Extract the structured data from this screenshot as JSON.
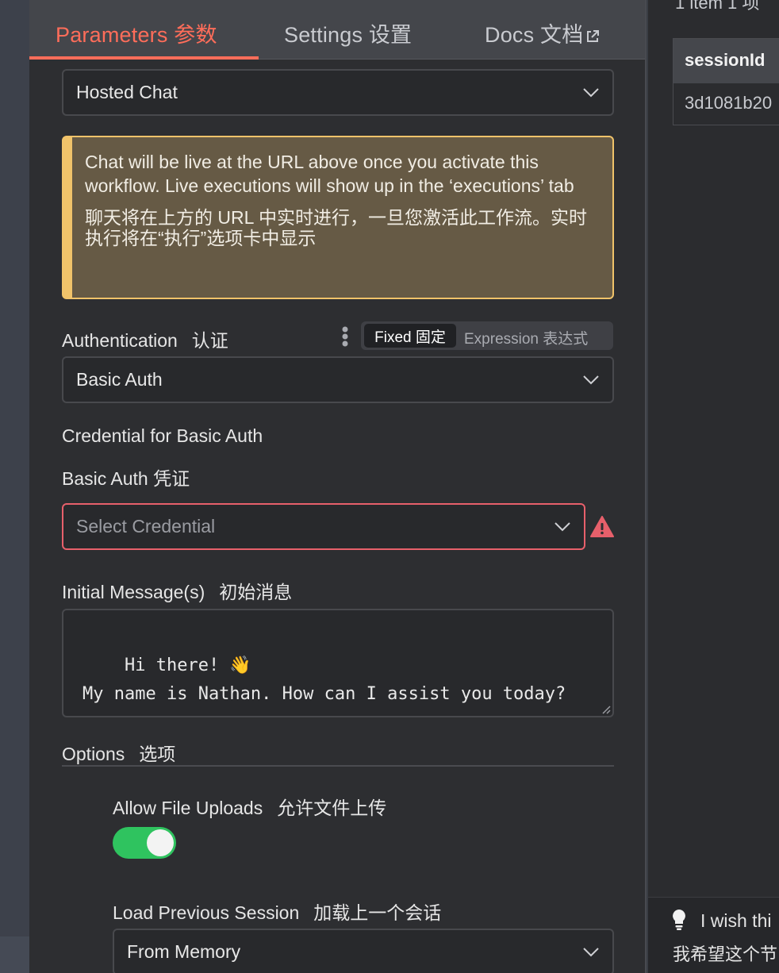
{
  "tabs": {
    "parameters": "Parameters  参数",
    "settings": "Settings  设置",
    "docs": "Docs  文档"
  },
  "mode_select": {
    "value": "Hosted Chat"
  },
  "notice": {
    "en": "Chat will be live at the URL above once you activate this workflow. Live executions will show up in the ‘executions’ tab",
    "zh": "聊天将在上方的 URL 中实时进行，一旦您激活此工作流。实时执行将在“执行”选项卡中显示"
  },
  "authentication": {
    "label": "Authentication",
    "label_zh": "认证",
    "fixed_label": "Fixed  固定",
    "expression_label": "Expression  表达式",
    "value": "Basic Auth"
  },
  "credential": {
    "label": "Credential for Basic Auth",
    "label_zh": "Basic Auth 凭证",
    "placeholder": "Select Credential"
  },
  "initial_messages": {
    "label": "Initial Message(s)",
    "label_zh": "初始消息",
    "value": "Hi there! 👋\nMy name is Nathan. How can I assist you today?"
  },
  "options": {
    "label": "Options",
    "label_zh": "选项",
    "allow_file_uploads": {
      "label": "Allow File Uploads",
      "label_zh": "允许文件上传",
      "enabled": true
    },
    "load_previous_session": {
      "label": "Load Previous Session",
      "label_zh": "加载上一个会话",
      "value": "From Memory"
    }
  },
  "right_panel": {
    "top_text": "1 item  1 项",
    "table_header": "sessionId",
    "table_cell": "3d1081b20",
    "feedback_text": "I wish thi",
    "feedback_zh": "我希望这个节"
  },
  "colors": {
    "accent": "#ff6d5a",
    "warning": "#f0c36a",
    "error": "#e7606b",
    "toggle_on": "#2fc35f"
  }
}
